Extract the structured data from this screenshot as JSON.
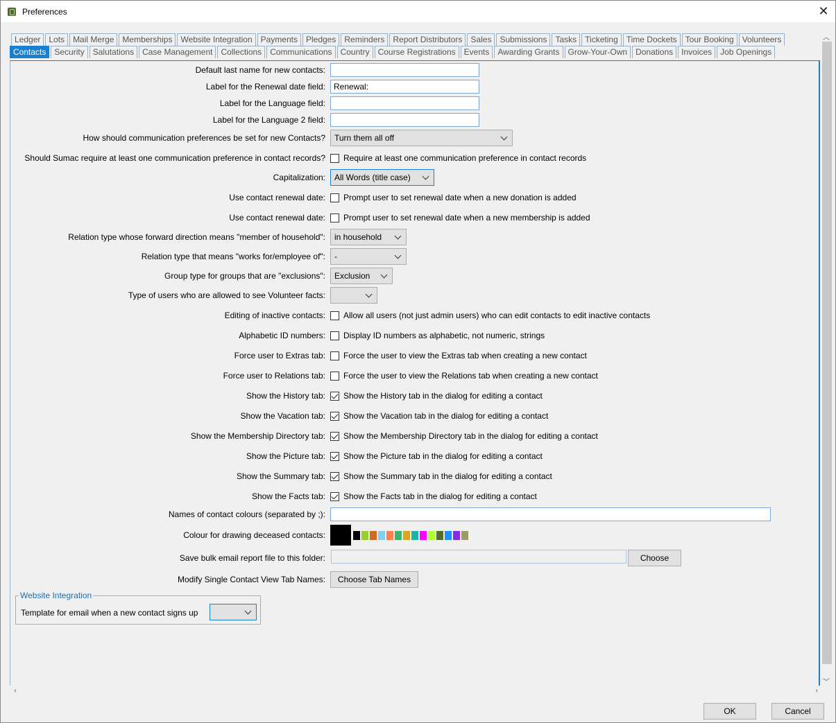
{
  "window": {
    "title": "Preferences",
    "close_glyph": "✕"
  },
  "tabs_row1": [
    "Ledger",
    "Lots",
    "Mail Merge",
    "Memberships",
    "Website Integration",
    "Payments",
    "Pledges",
    "Reminders",
    "Report Distributors",
    "Sales",
    "Submissions",
    "Tasks",
    "Ticketing",
    "Time Dockets",
    "Tour Booking",
    "Volunteers"
  ],
  "tabs_row2": [
    "Contacts",
    "Security",
    "Salutations",
    "Case Management",
    "Collections",
    "Communications",
    "Country",
    "Course Registrations",
    "Events",
    "Awarding Grants",
    "Grow-Your-Own",
    "Donations",
    "Invoices",
    "Job Openings"
  ],
  "fields": {
    "default_last_name": {
      "label": "Default last name for new contacts:",
      "value": ""
    },
    "renewal_label": {
      "label": "Label for the Renewal date field:",
      "value": "Renewal:"
    },
    "language_label": {
      "label": "Label for the Language field:",
      "value": ""
    },
    "language2_label": {
      "label": "Label for the Language 2 field:",
      "value": ""
    },
    "comm_pref": {
      "label": "How should communication preferences be set for new Contacts?",
      "value": "Turn them all off"
    },
    "require_comm": {
      "label": "Should Sumac require at least one communication preference in contact records?",
      "text": "Require at least one communication preference in contact records",
      "checked": false
    },
    "capitalization": {
      "label": "Capitalization:",
      "value": "All Words (title case)"
    },
    "renewal_donation": {
      "label": "Use contact renewal date:",
      "text": "Prompt user to set renewal date when a new donation is added",
      "checked": false
    },
    "renewal_membership": {
      "label": "Use contact renewal date:",
      "text": "Prompt user to set renewal date when a new membership is added",
      "checked": false
    },
    "household": {
      "label": "Relation type whose forward direction means \"member of household\":",
      "value": "in household"
    },
    "employee": {
      "label": "Relation type that means \"works for/employee of\":",
      "value": "-"
    },
    "exclusions": {
      "label": "Group type for groups that are \"exclusions\":",
      "value": "Exclusion"
    },
    "volunteer_facts": {
      "label": "Type of users who are allowed to see Volunteer facts:",
      "value": ""
    },
    "inactive": {
      "label": "Editing of inactive contacts:",
      "text": "Allow all users (not just admin users) who can edit contacts to edit inactive contacts",
      "checked": false
    },
    "alpha_id": {
      "label": "Alphabetic ID numbers:",
      "text": "Display ID numbers as alphabetic, not numeric, strings",
      "checked": false
    },
    "extras": {
      "label": "Force user to Extras tab:",
      "text": "Force the user to view the Extras tab when creating a new contact",
      "checked": false
    },
    "relations": {
      "label": "Force user to Relations tab:",
      "text": "Force the user to view the Relations tab when creating a new contact",
      "checked": false
    },
    "history": {
      "label": "Show the History tab:",
      "text": "Show the History tab in the dialog for editing a contact",
      "checked": true
    },
    "vacation": {
      "label": "Show the Vacation tab:",
      "text": "Show the Vacation tab in the dialog for editing a contact",
      "checked": true
    },
    "membership_dir": {
      "label": "Show the Membership Directory tab:",
      "text": "Show the Membership Directory tab in the dialog for editing a contact",
      "checked": true
    },
    "picture": {
      "label": "Show the Picture tab:",
      "text": "Show the Picture tab in the dialog for editing a contact",
      "checked": true
    },
    "summary": {
      "label": "Show the Summary tab:",
      "text": "Show the Summary tab in the dialog for editing a contact",
      "checked": true
    },
    "facts": {
      "label": "Show the Facts tab:",
      "text": "Show the Facts tab in the dialog for editing a contact",
      "checked": true
    },
    "colour_names": {
      "label": "Names of contact colours (separated by ;):",
      "value": ""
    },
    "deceased_colour": {
      "label": "Colour for drawing deceased contacts:",
      "selected": "#000000",
      "palette": [
        "#000000",
        "#9acd32",
        "#d2691e",
        "#87ceeb",
        "#ff7f50",
        "#3cb371",
        "#daa520",
        "#20b2aa",
        "#ff00ff",
        "#adff2f",
        "#556b2f",
        "#1e90ff",
        "#8a2be2",
        "#9c9c6a"
      ]
    },
    "bulk_email": {
      "label": "Save bulk email report file to this folder:",
      "value": "",
      "button": "Choose"
    },
    "tab_names": {
      "label": "Modify Single Contact View Tab Names:",
      "button": "Choose Tab Names"
    }
  },
  "website_group": {
    "title": "Website Integration",
    "label": "Template for email when a new contact signs up",
    "value": ""
  },
  "footer": {
    "ok": "OK",
    "cancel": "Cancel"
  }
}
